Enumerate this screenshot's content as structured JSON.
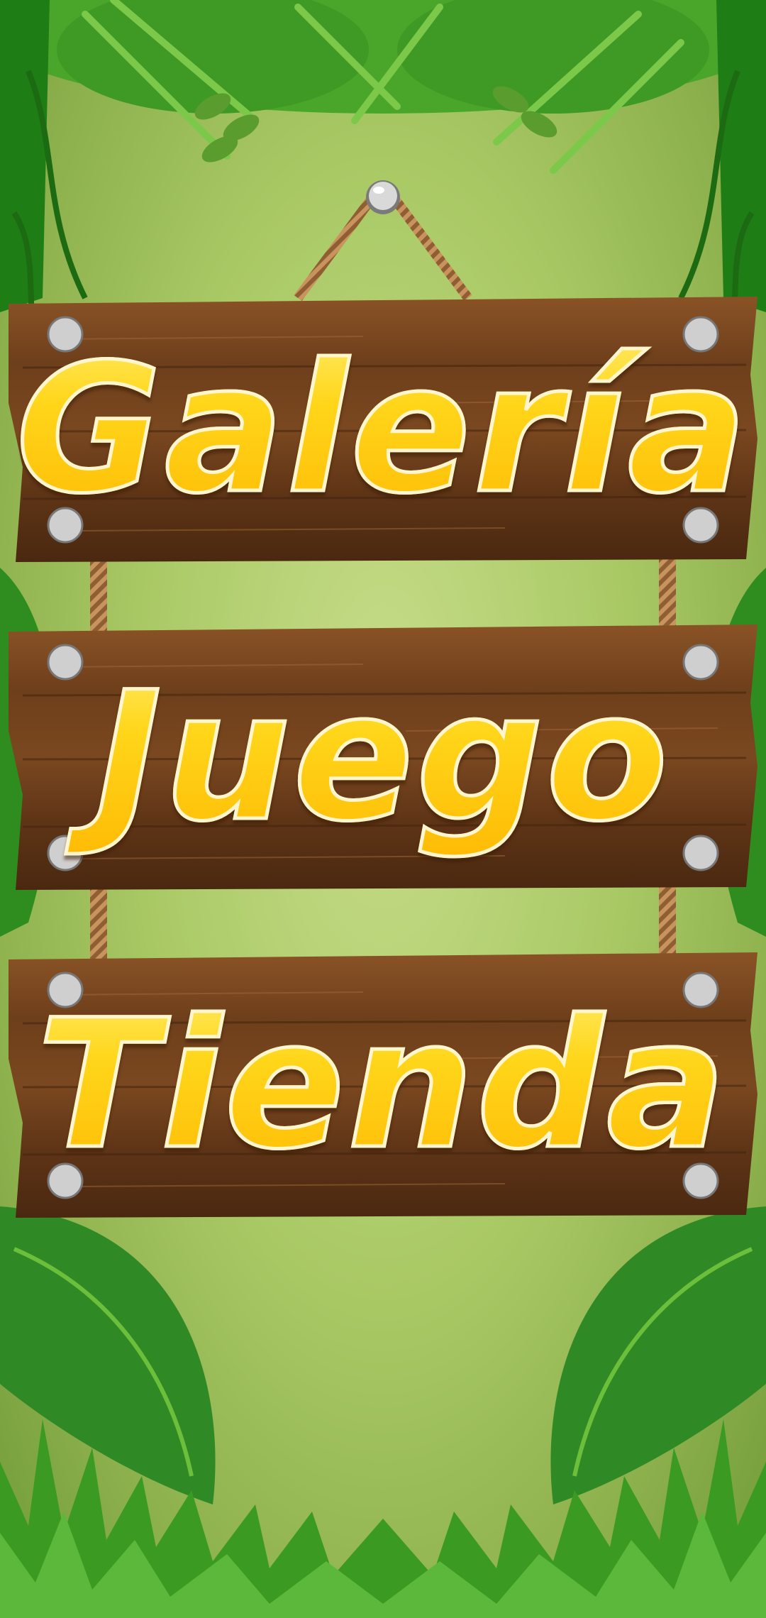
{
  "menu": {
    "items": [
      {
        "label": "Galería"
      },
      {
        "label": "Juego"
      },
      {
        "label": "Tienda"
      }
    ]
  },
  "colors": {
    "wood": "#6b3d1a",
    "wood_light": "#8a5326",
    "text_fill": "#ffcc00",
    "text_outline": "#fff6d0",
    "bolt": "#c9c9c9",
    "rope": "#b9865a",
    "jungle_dark": "#2e8a1e",
    "jungle_light": "#6cbf3a"
  },
  "icons": {
    "hanger": "nail-icon",
    "bolts": "bolt-icon",
    "rope": "rope-icon"
  }
}
